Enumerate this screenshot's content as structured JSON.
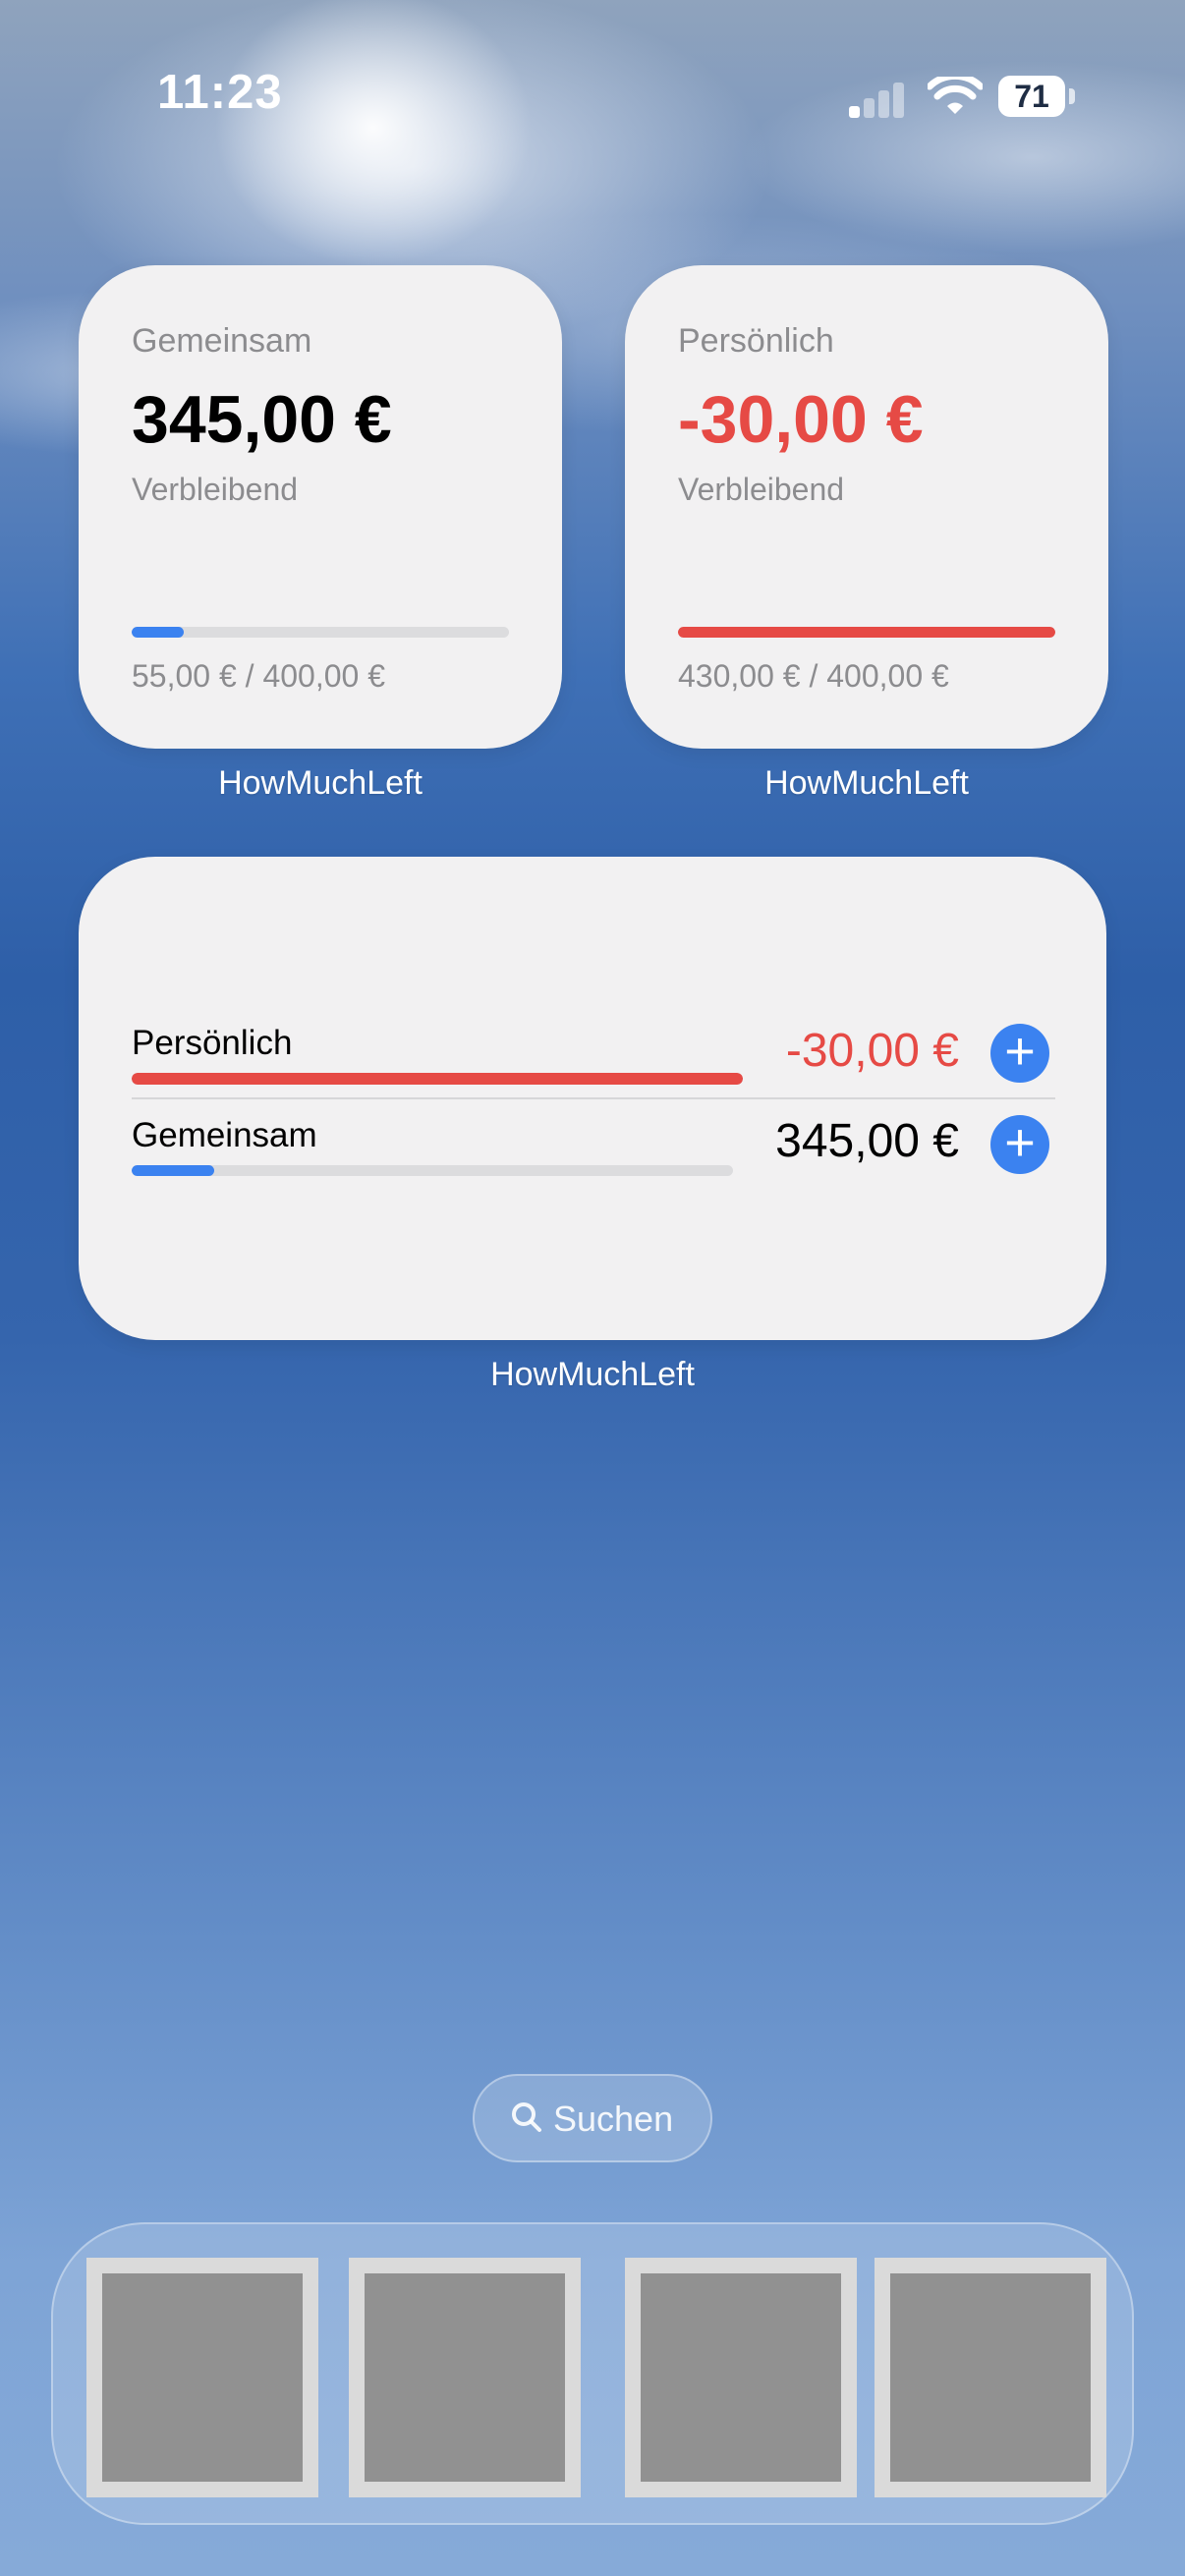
{
  "status_bar": {
    "time": "11:23",
    "battery": "71",
    "icons": [
      "cellular-signal-icon",
      "wifi-icon",
      "battery-icon"
    ]
  },
  "widgets": {
    "small_shared": {
      "title": "Gemeinsam",
      "amount": "345,00 €",
      "subtitle": "Verbleibend",
      "progress": 0.1375,
      "progress_color": "#3b82f0",
      "footer": "55,00 € / 400,00 €",
      "caption": "HowMuchLeft"
    },
    "small_personal": {
      "title": "Persönlich",
      "amount": "-30,00 €",
      "subtitle": "Verbleibend",
      "progress": 1.0,
      "progress_color": "#e64a45",
      "footer": "430,00 € / 400,00 €",
      "caption": "HowMuchLeft"
    },
    "large": {
      "caption": "HowMuchLeft",
      "rows": [
        {
          "name": "Persönlich",
          "amount": "-30,00 €",
          "amount_color": "#e64a45",
          "progress": 1.0,
          "progress_color": "#e64a45"
        },
        {
          "name": "Gemeinsam",
          "amount": "345,00 €",
          "amount_color": "#000000",
          "progress": 0.1375,
          "progress_color": "#3b82f0"
        }
      ],
      "add_label": "+"
    }
  },
  "search": {
    "label": "Suchen"
  },
  "dock": {
    "apps": [
      "app-1",
      "app-2",
      "app-3",
      "app-4"
    ]
  },
  "colors": {
    "accent_blue": "#3b82f0",
    "negative_red": "#e64a45",
    "widget_bg": "#f2f1f2"
  }
}
